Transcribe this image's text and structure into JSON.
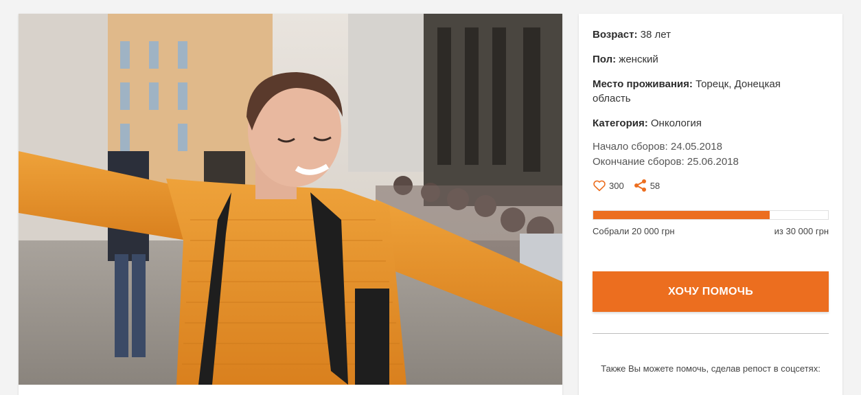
{
  "photo": {
    "alt": ""
  },
  "profile": {
    "age_label": "Возраст:",
    "age_value": "38 лет",
    "sex_label": "Пол:",
    "sex_value": "женский",
    "place_label": "Место проживания:",
    "place_value": "Торецк, Донецкая область",
    "category_label": "Категория:",
    "category_value": "Онкология"
  },
  "dates": {
    "start": "Начало сборов: 24.05.2018",
    "end": "Окончание сборов: 25.06.2018"
  },
  "stats": {
    "likes": "300",
    "shares": "58",
    "like_icon": "heart-icon",
    "share_icon": "share-icon"
  },
  "progress": {
    "fraction": 0.75,
    "raised": "Собрали 20 000 грн",
    "goal": "из 30 000 грн"
  },
  "cta": {
    "label": "Хочу помочь"
  },
  "share_note": "Также Вы можете помочь, сделав репост в соцсетях:",
  "colors": {
    "accent": "#ec6e1f",
    "sweater": "#e8962c"
  }
}
